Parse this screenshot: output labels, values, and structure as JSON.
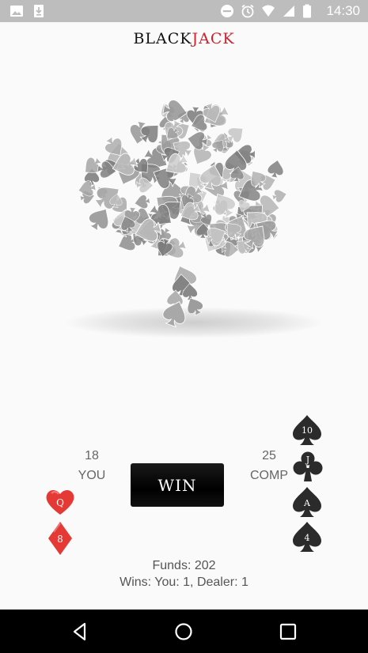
{
  "status_bar": {
    "time": "14:30",
    "left_icons": [
      "image-icon",
      "download-icon"
    ],
    "right_icons": [
      "do-not-disturb-icon",
      "alarm-icon",
      "wifi-icon",
      "signal-icon",
      "battery-icon"
    ]
  },
  "app": {
    "title_part1": "BLACK",
    "title_part2": "JACK",
    "brand_red": "#d21f2b"
  },
  "player": {
    "score": "18",
    "label": "YOU",
    "cards": [
      {
        "rank": "Q",
        "suit": "hearts",
        "color": "#e53935"
      },
      {
        "rank": "8",
        "suit": "diamonds",
        "color": "#e53935"
      }
    ]
  },
  "dealer": {
    "score": "25",
    "label": "COMP",
    "cards": [
      {
        "rank": "10",
        "suit": "spades",
        "color": "#2b2b2b"
      },
      {
        "rank": "J",
        "suit": "clubs",
        "color": "#2b2b2b"
      },
      {
        "rank": "A",
        "suit": "spades",
        "color": "#2b2b2b"
      },
      {
        "rank": "4",
        "suit": "spades",
        "color": "#2b2b2b"
      }
    ]
  },
  "result": {
    "label": "WIN"
  },
  "stats": {
    "funds": "Funds: 202",
    "wins": "Wins: You: 1, Dealer: 1"
  },
  "nav": {
    "buttons": [
      "back-icon",
      "home-icon",
      "recents-icon"
    ]
  }
}
